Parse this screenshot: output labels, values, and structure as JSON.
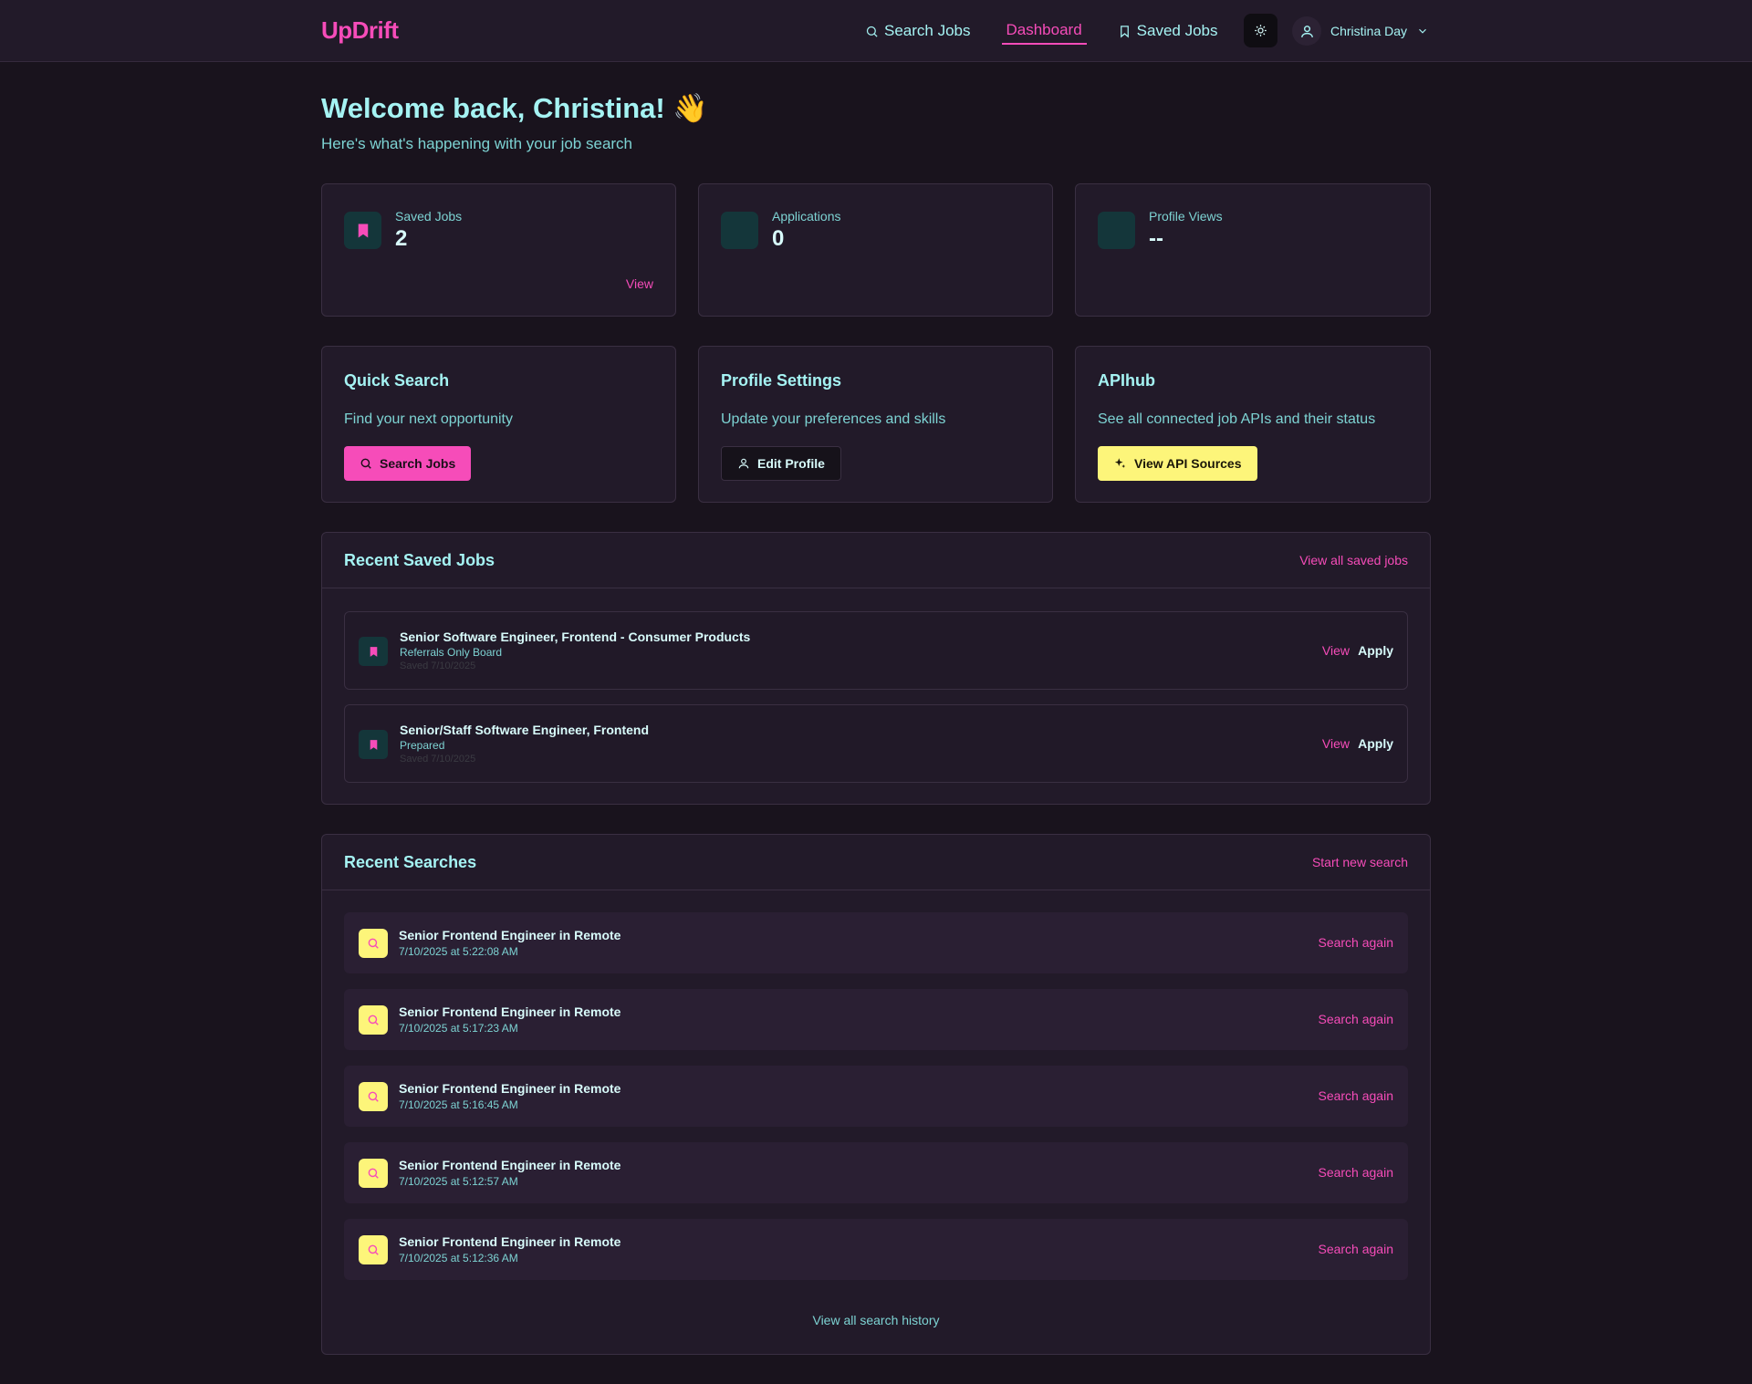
{
  "header": {
    "logo": "UpDrift",
    "nav": [
      {
        "label": "Search Jobs"
      },
      {
        "label": "Dashboard"
      },
      {
        "label": "Saved Jobs"
      }
    ],
    "user_name": "Christina Day"
  },
  "welcome": {
    "title": "Welcome back, Christina! 👋",
    "subtitle": "Here's what's happening with your job search"
  },
  "stats": [
    {
      "label": "Saved Jobs",
      "value": "2",
      "link": "View"
    },
    {
      "label": "Applications",
      "value": "0"
    },
    {
      "label": "Profile Views",
      "value": "--"
    }
  ],
  "quick_actions": [
    {
      "title": "Quick Search",
      "desc": "Find your next opportunity",
      "button": "Search Jobs"
    },
    {
      "title": "Profile Settings",
      "desc": "Update your preferences and skills",
      "button": "Edit Profile"
    },
    {
      "title": "APIhub",
      "desc": "See all connected job APIs and their status",
      "button": "View API Sources"
    }
  ],
  "recent_saved": {
    "title": "Recent Saved Jobs",
    "link": "View all saved jobs",
    "view_label": "View",
    "apply_label": "Apply",
    "jobs": [
      {
        "title": "Senior Software Engineer, Frontend - Consumer Products",
        "company": "Referrals Only Board",
        "saved": "Saved 7/10/2025"
      },
      {
        "title": "Senior/Staff Software Engineer, Frontend",
        "company": "Prepared",
        "saved": "Saved 7/10/2025"
      }
    ]
  },
  "recent_searches": {
    "title": "Recent Searches",
    "link": "Start new search",
    "again_label": "Search again",
    "history_link": "View all search history",
    "items": [
      {
        "query": "Senior Frontend Engineer in Remote",
        "time": "7/10/2025 at 5:22:08 AM"
      },
      {
        "query": "Senior Frontend Engineer in Remote",
        "time": "7/10/2025 at 5:17:23 AM"
      },
      {
        "query": "Senior Frontend Engineer in Remote",
        "time": "7/10/2025 at 5:16:45 AM"
      },
      {
        "query": "Senior Frontend Engineer in Remote",
        "time": "7/10/2025 at 5:12:57 AM"
      },
      {
        "query": "Senior Frontend Engineer in Remote",
        "time": "7/10/2025 at 5:12:36 AM"
      }
    ]
  },
  "colors": {
    "accent_pink": "#f64cb9",
    "accent_cyan": "#a5f3f3",
    "accent_yellow": "#fdf57a",
    "background": "#19131d",
    "card": "#221a29"
  },
  "icons": {
    "nav_search": "search-icon",
    "nav_saved": "bookmark-icon",
    "theme": "sun-icon",
    "user": "user-icon",
    "menu": "chevron-down-icon",
    "api": "sparkles-icon"
  }
}
